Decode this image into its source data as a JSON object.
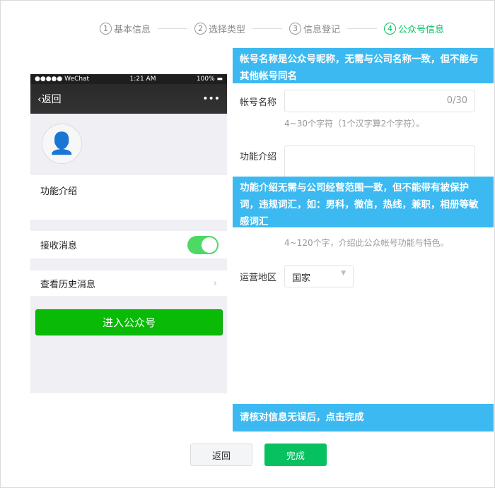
{
  "steps": [
    {
      "num": "1",
      "label": "基本信息"
    },
    {
      "num": "2",
      "label": "选择类型"
    },
    {
      "num": "3",
      "label": "信息登记"
    },
    {
      "num": "4",
      "label": "公众号信息"
    }
  ],
  "phone": {
    "carrier": "●●●●● WeChat",
    "time": "1:21 AM",
    "battery": "100%",
    "back": "返回",
    "more": "•••",
    "intro": "功能介绍",
    "receive": "接收消息",
    "history": "查看历史消息",
    "enter": "进入公众号"
  },
  "tips": {
    "name": "帐号名称是公众号昵称，无需与公司名称一致，但不能与其他帐号同名",
    "intro": "功能介绍无需与公司经营范围一致，但不能带有被保护词，违规词汇，如：男科，微信，热线，兼职，相册等敏感词汇",
    "confirm": "请核对信息无误后，点击完成"
  },
  "form": {
    "name_label": "帐号名称",
    "name_counter": "0/30",
    "name_hint": "4~30个字符（1个汉字算2个字符）。",
    "intro_label": "功能介绍",
    "intro_hint": "4~120个字，介绍此公众帐号功能与特色。",
    "region_label": "运营地区",
    "region_value": "国家"
  },
  "buttons": {
    "back": "返回",
    "done": "完成"
  }
}
